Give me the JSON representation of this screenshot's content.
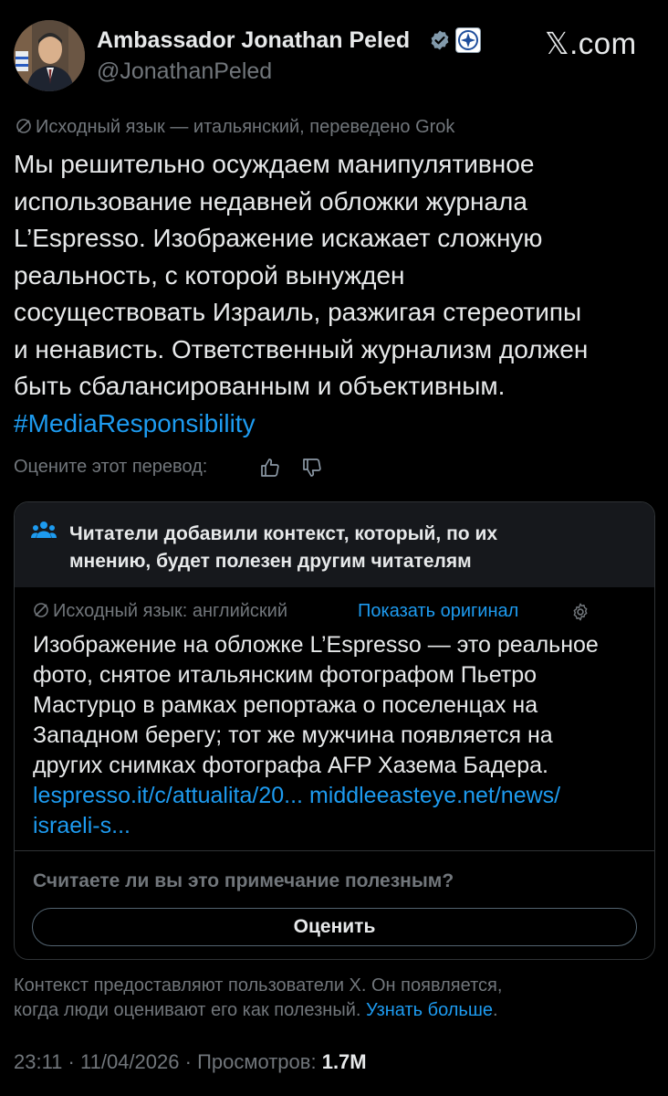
{
  "header": {
    "author_name": "Ambassador Jonathan Peled",
    "handle": "@JonathanPeled",
    "site_logo": "𝕏.com",
    "avatar_icon": "profile-photo",
    "verified_icon": "verified-badge-icon",
    "affiliation_icon": "government-affiliation-badge-icon"
  },
  "translation": {
    "notice": "Исходный язык — итальянский, переведено Grok",
    "icon": "globe-icon"
  },
  "tweet": {
    "lines": [
      "Мы решительно осуждаем манипулятивное",
      "использование недавней обложки журнала",
      "L’Espresso. Изображение искажает сложную",
      "реальность, с которой вынужден",
      "сосуществовать Израиль, разжигая стереотипы",
      "и ненависть. Ответственный журнализм должен",
      "быть сбалансированным и объективным."
    ],
    "hashtag": "#MediaResponsibility"
  },
  "rate_translation": {
    "label": "Оцените этот перевод:",
    "thumbs_up_icon": "thumbs-up-icon",
    "thumbs_down_icon": "thumbs-down-icon"
  },
  "community_note": {
    "header_lines": [
      "Читатели добавили контекст, который, по их",
      "мнению, будет полезен другим читателям"
    ],
    "header_icon": "people-icon",
    "source_language": "Исходный язык: английский",
    "show_original": "Показать оригинал",
    "settings_icon": "gear-icon",
    "body_lines": [
      "Изображение на обложке L’Espresso — это реальное",
      "фото, снятое итальянским фотографом Пьетро",
      "Мастурцо в рамках репортажа о поселенцах на",
      "Западном берегу; тот же мужчина появляется на",
      "других снимках фотографа AFP Хазема Бадера."
    ],
    "link1": "lespresso.it/c/attualita/20...",
    "link2": "middleeasteye.net/news/",
    "link2_cont": "israeli-s...",
    "helpful_question": "Считаете ли вы это примечание полезным?",
    "rate_button": "Оценить"
  },
  "footer": {
    "line1": "Контекст предоставляют пользователи X. Он появляется,",
    "line2": "когда люди оценивают его как полезный.",
    "learn_more": "Узнать больше",
    "period": "."
  },
  "meta": {
    "time": "23:11",
    "date": "11/04/2026",
    "views_label": "Просмотров:",
    "views_count": "1.7M",
    "separator": "·"
  },
  "colors": {
    "background": "#000000",
    "text": "#e7e9ea",
    "secondary": "#71767b",
    "link": "#1d9bf0",
    "card_header": "#16181c",
    "border": "#2f3336"
  }
}
